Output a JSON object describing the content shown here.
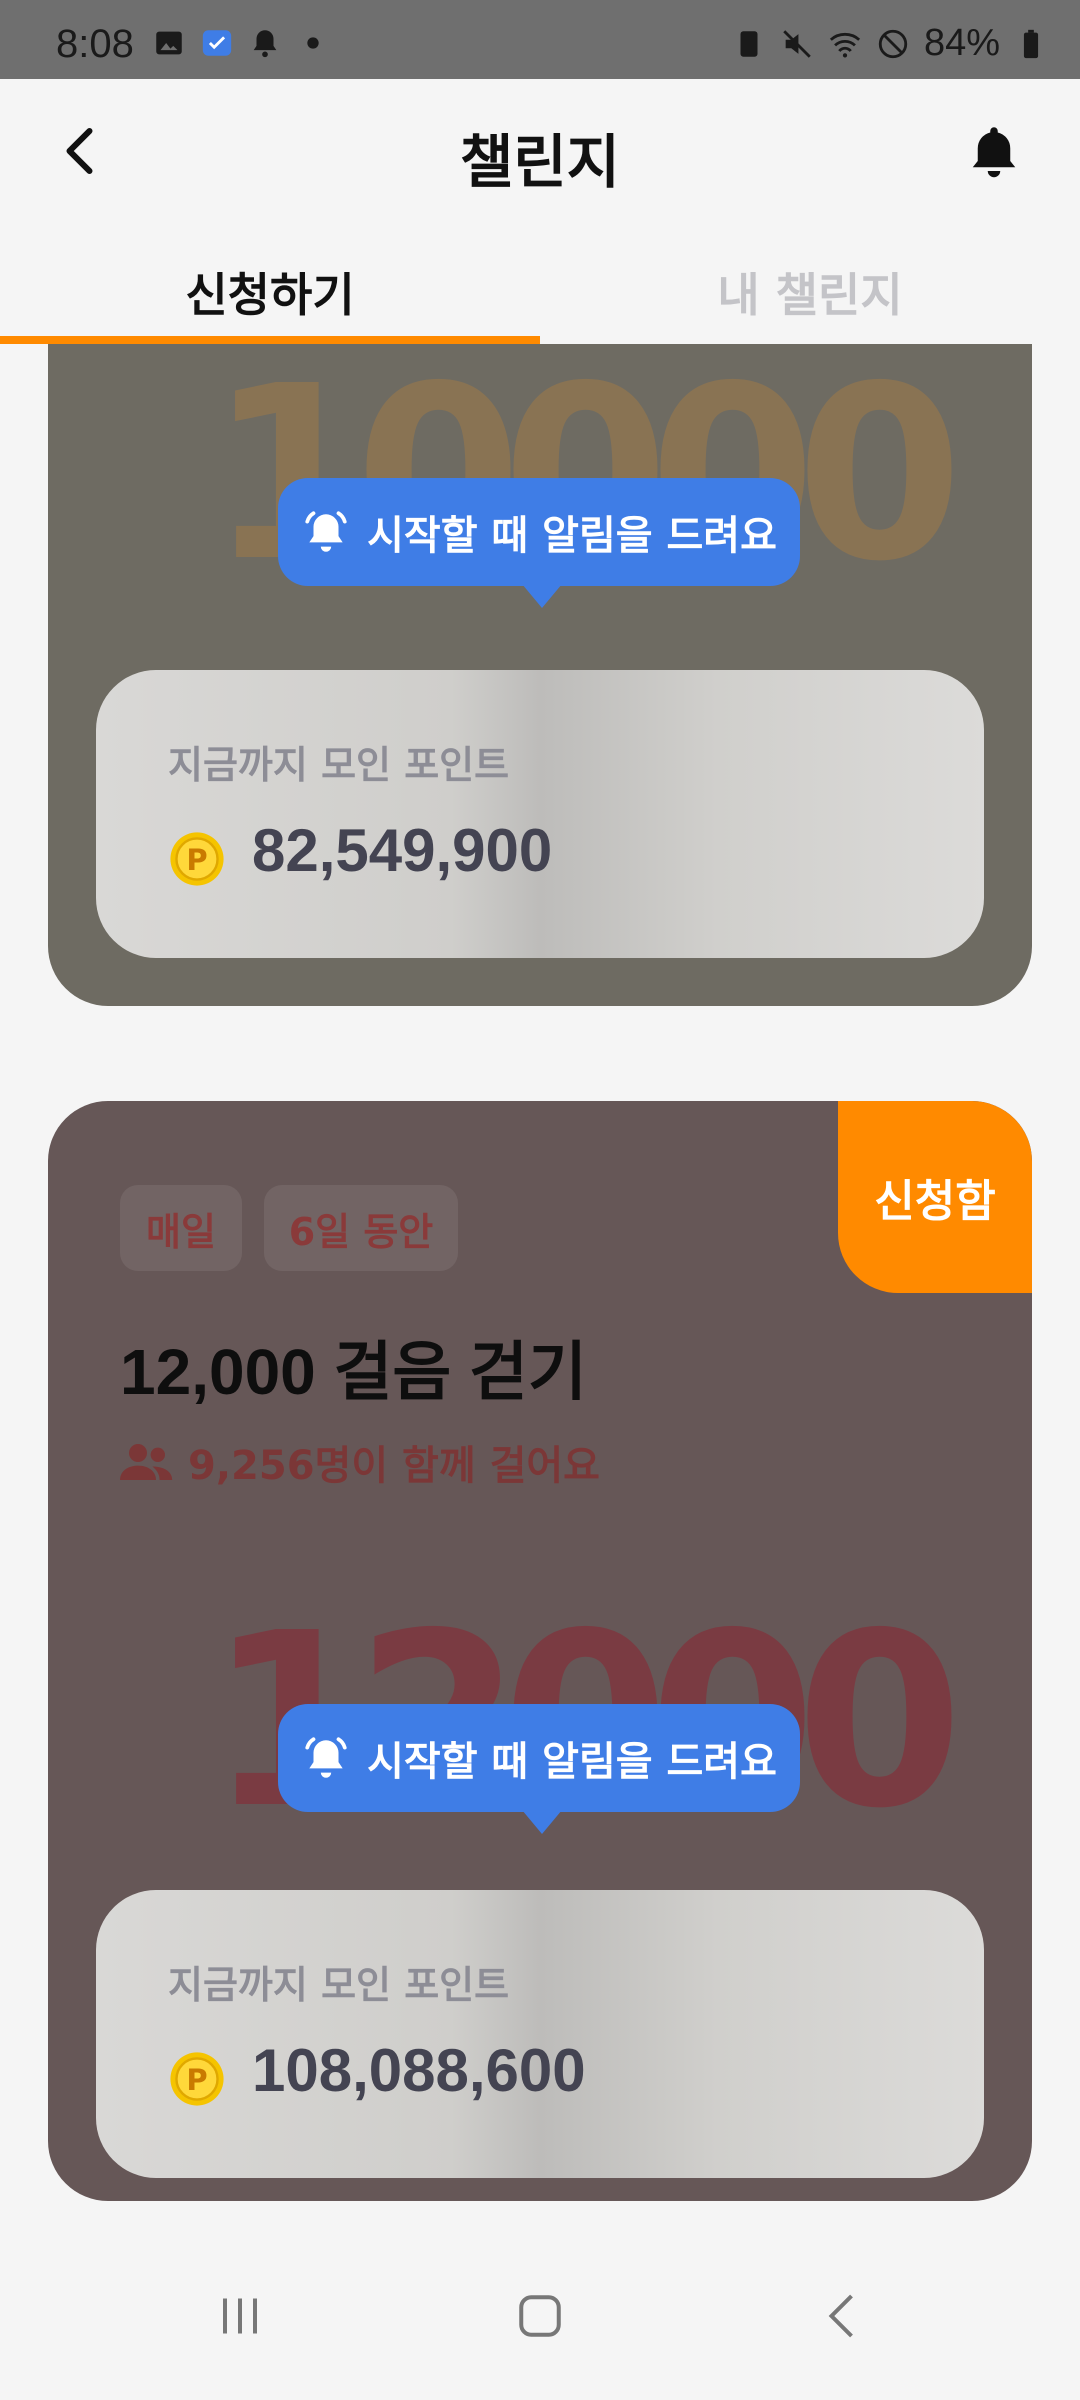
{
  "status_bar": {
    "time": "8:08",
    "battery": "84%"
  },
  "header": {
    "title": "챌린지",
    "back_icon": "chevron-left-icon",
    "bell_icon": "bell-icon"
  },
  "tabs": [
    {
      "label": "신청하기",
      "active": true
    },
    {
      "label": "내 챌린지",
      "active": false
    }
  ],
  "cards": [
    {
      "image_number": "10000",
      "tooltip": "시작할 때 알림을 드려요",
      "points_label": "지금까지 모인 포인트",
      "points_value": "82,549,900"
    },
    {
      "badge": "신청함",
      "chips": [
        "매일",
        "6일 동안"
      ],
      "title": "12,000 걸음 걷기",
      "participants": "9,256명이 함께 걸어요",
      "image_number": "12000",
      "tooltip": "시작할 때 알림을 드려요",
      "points_label": "지금까지 모인 포인트",
      "points_value": "108,088,600"
    }
  ],
  "colors": {
    "accent": "#ff8a00",
    "tooltip": "#3f7de6"
  }
}
